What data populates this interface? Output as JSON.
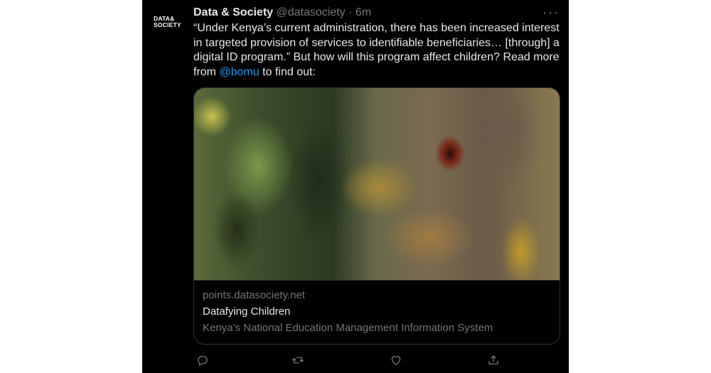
{
  "author": {
    "avatar_line1": "DATA&",
    "avatar_line2": "SOCIETY",
    "name": "Data & Society",
    "handle": "@datasociety",
    "separator": "·",
    "time": "6m"
  },
  "more_menu": "···",
  "tweet": {
    "text_before_mention": "“Under Kenya’s current administration, there has been increased interest in targeted provision of services to identifiable beneficiaries… [through] a digital ID program.” But how will this program affect children? Read more from ",
    "mention": "@bomu",
    "text_after_mention": " to find out:"
  },
  "link_card": {
    "image_description_icon": "satellite-image",
    "domain": "points.datasociety.net",
    "title": "Datafying Children",
    "description": "Kenya’s National Education Management Information System"
  },
  "actions": {
    "reply_icon": "reply-icon",
    "retweet_icon": "retweet-icon",
    "like_icon": "heart-icon",
    "share_icon": "share-icon"
  },
  "colors": {
    "background": "#000000",
    "text": "#e7e9ea",
    "secondary": "#71767b",
    "accent": "#1d9bf0",
    "border": "#2f3336"
  }
}
